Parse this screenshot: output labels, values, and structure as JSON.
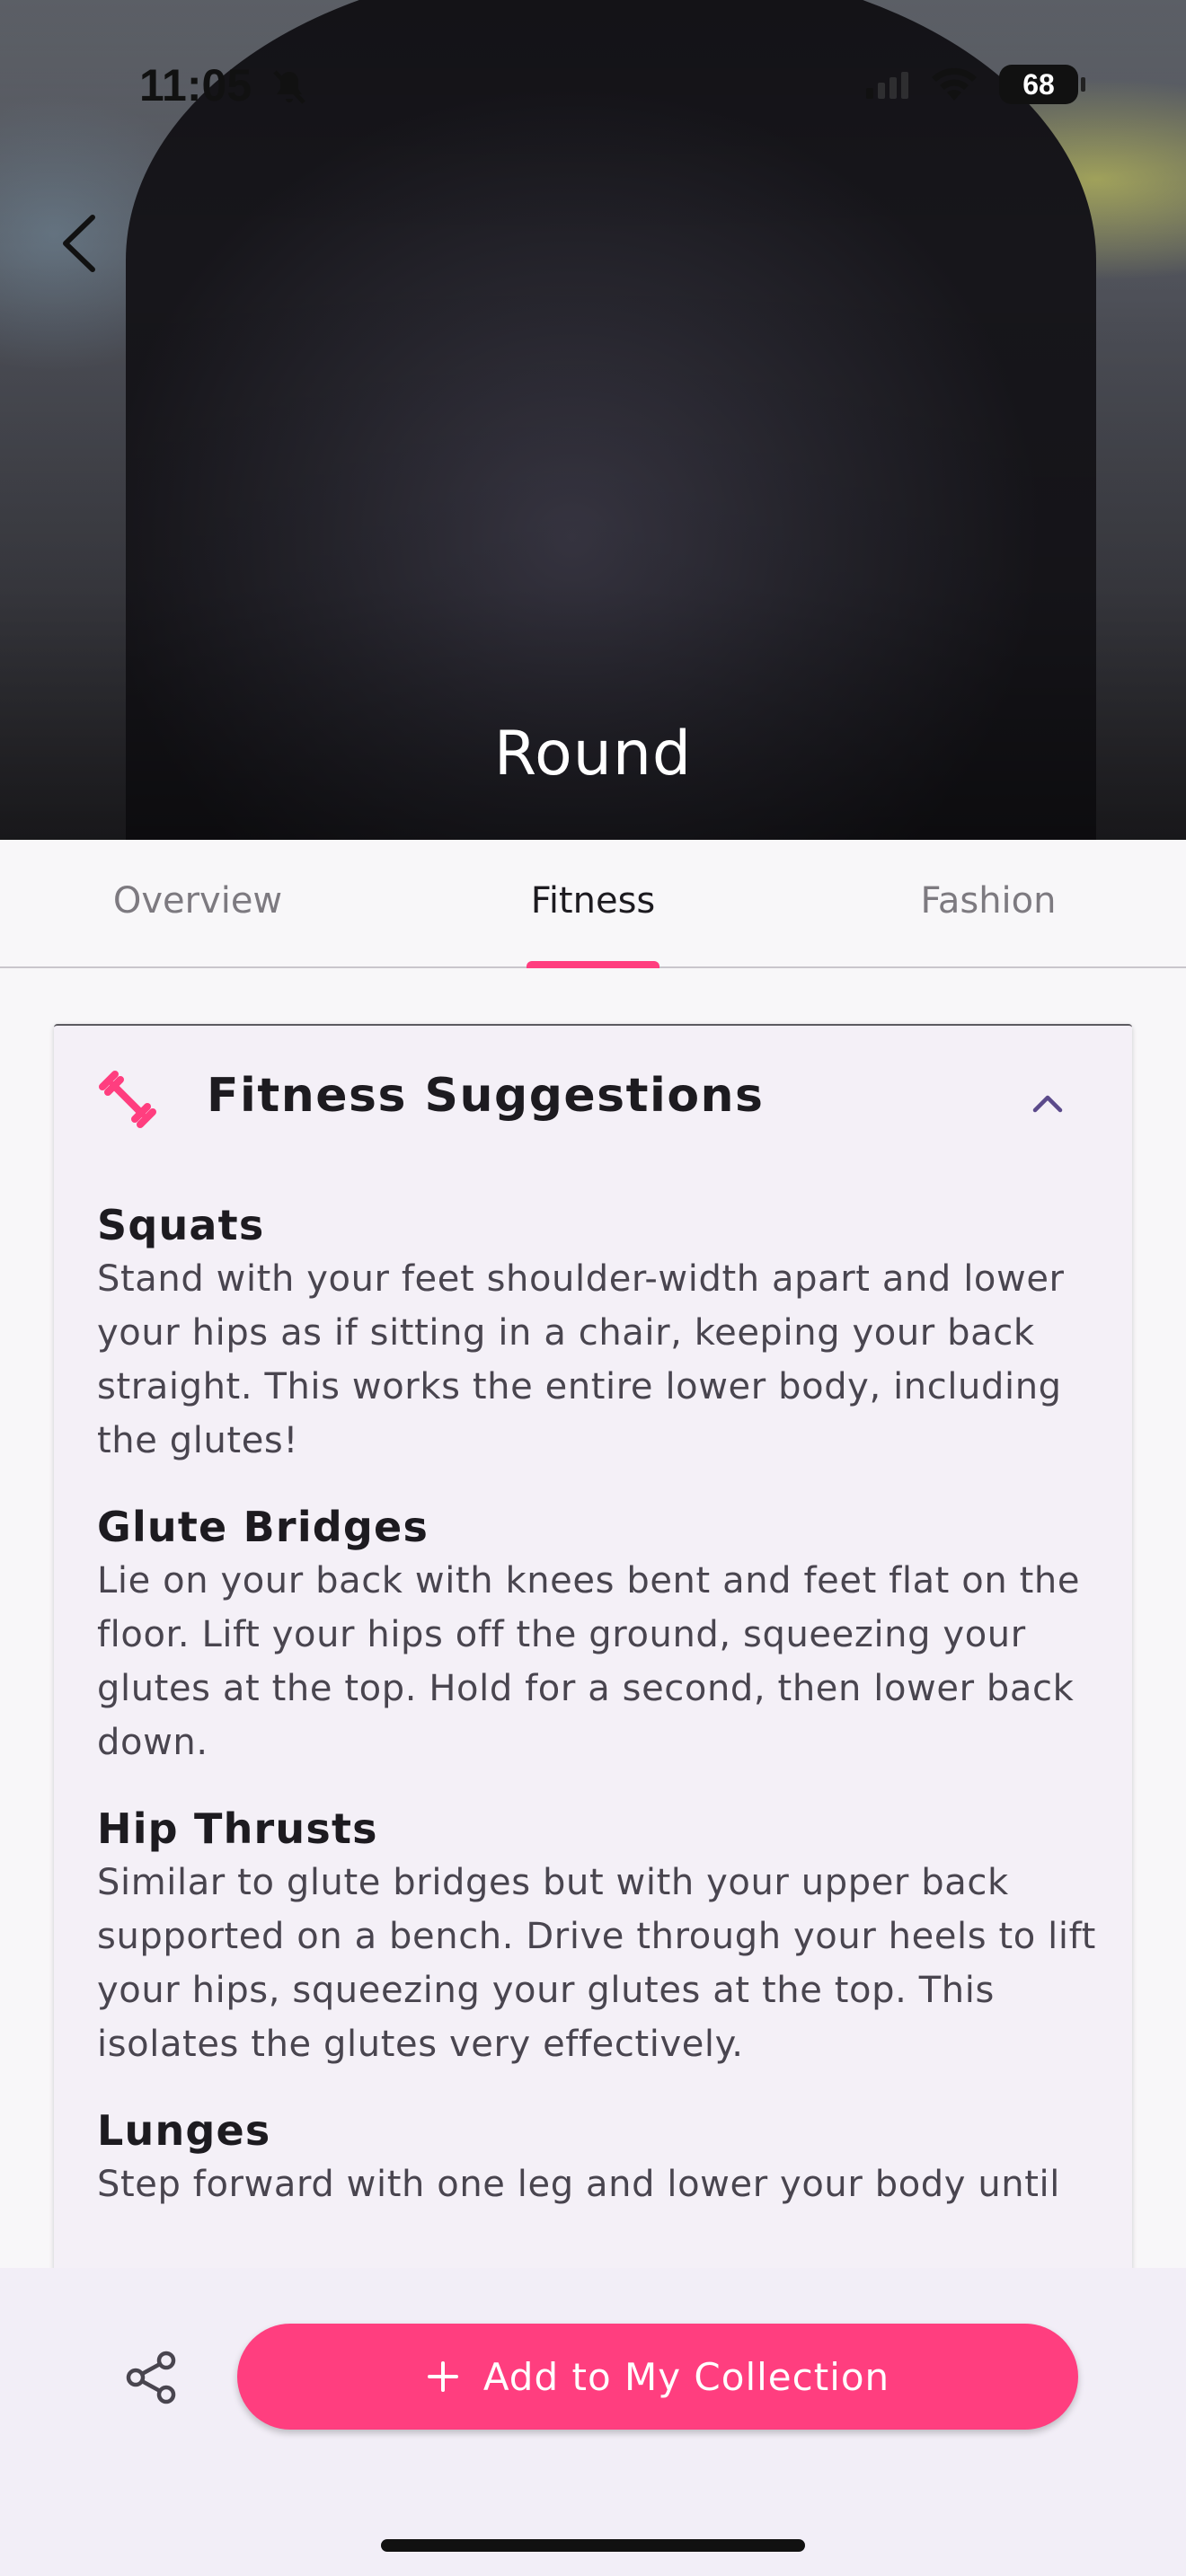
{
  "status_bar": {
    "time": "11:05",
    "battery": "68"
  },
  "hero": {
    "title": "Round"
  },
  "tabs": [
    {
      "label": "Overview",
      "active": false
    },
    {
      "label": "Fitness",
      "active": true
    },
    {
      "label": "Fashion",
      "active": false
    }
  ],
  "card": {
    "title": "Fitness Suggestions",
    "exercises": [
      {
        "name": "Squats",
        "description": "Stand with your feet shoulder-width apart and lower your hips as if sitting in a chair, keeping your back straight. This works the entire lower body, including the glutes!"
      },
      {
        "name": "Glute Bridges",
        "description": "Lie on your back with knees bent and feet flat on the floor. Lift your hips off the ground, squeezing your glutes at the top. Hold for a second, then lower back down."
      },
      {
        "name": "Hip Thrusts",
        "description": "Similar to glute bridges but with your upper back supported on a bench. Drive through your heels to lift your hips, squeezing your glutes at the top. This isolates the glutes very effectively."
      },
      {
        "name": "Lunges",
        "description": "Step forward with one leg and lower your body until"
      }
    ]
  },
  "bottom_bar": {
    "add_label": "Add to My Collection"
  },
  "colors": {
    "accent": "#ff3e7f",
    "card_bg": "#f4f0f7",
    "bottom_bg": "#f2eef7",
    "text_primary": "#1d1b20",
    "text_secondary": "#49454f"
  },
  "icons": {
    "back": "chevron-left-icon",
    "dumbbell": "dumbbell-icon",
    "collapse": "chevron-up-icon",
    "share": "share-icon",
    "plus": "plus-icon"
  }
}
